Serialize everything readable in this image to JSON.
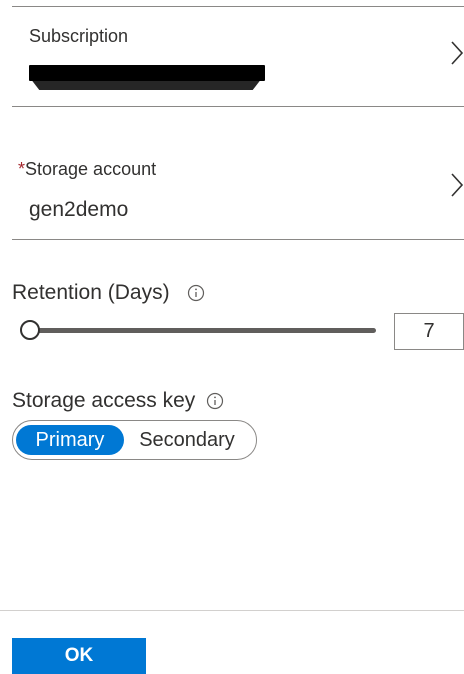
{
  "subscription": {
    "label": "Subscription",
    "value_redacted": true
  },
  "storage_account": {
    "required_marker": "*",
    "label": "Storage account",
    "value": "gen2demo"
  },
  "retention": {
    "label": "Retention (Days)",
    "value": "7",
    "slider_fraction": 0.0
  },
  "access_key": {
    "label": "Storage access key",
    "options": [
      "Primary",
      "Secondary"
    ],
    "selected": "Primary"
  },
  "footer": {
    "ok_label": "OK"
  },
  "colors": {
    "accent": "#0078d4",
    "required": "#a4262c",
    "text": "#323130"
  },
  "icons": {
    "chevron": "chevron-right-icon",
    "info": "info-icon"
  }
}
